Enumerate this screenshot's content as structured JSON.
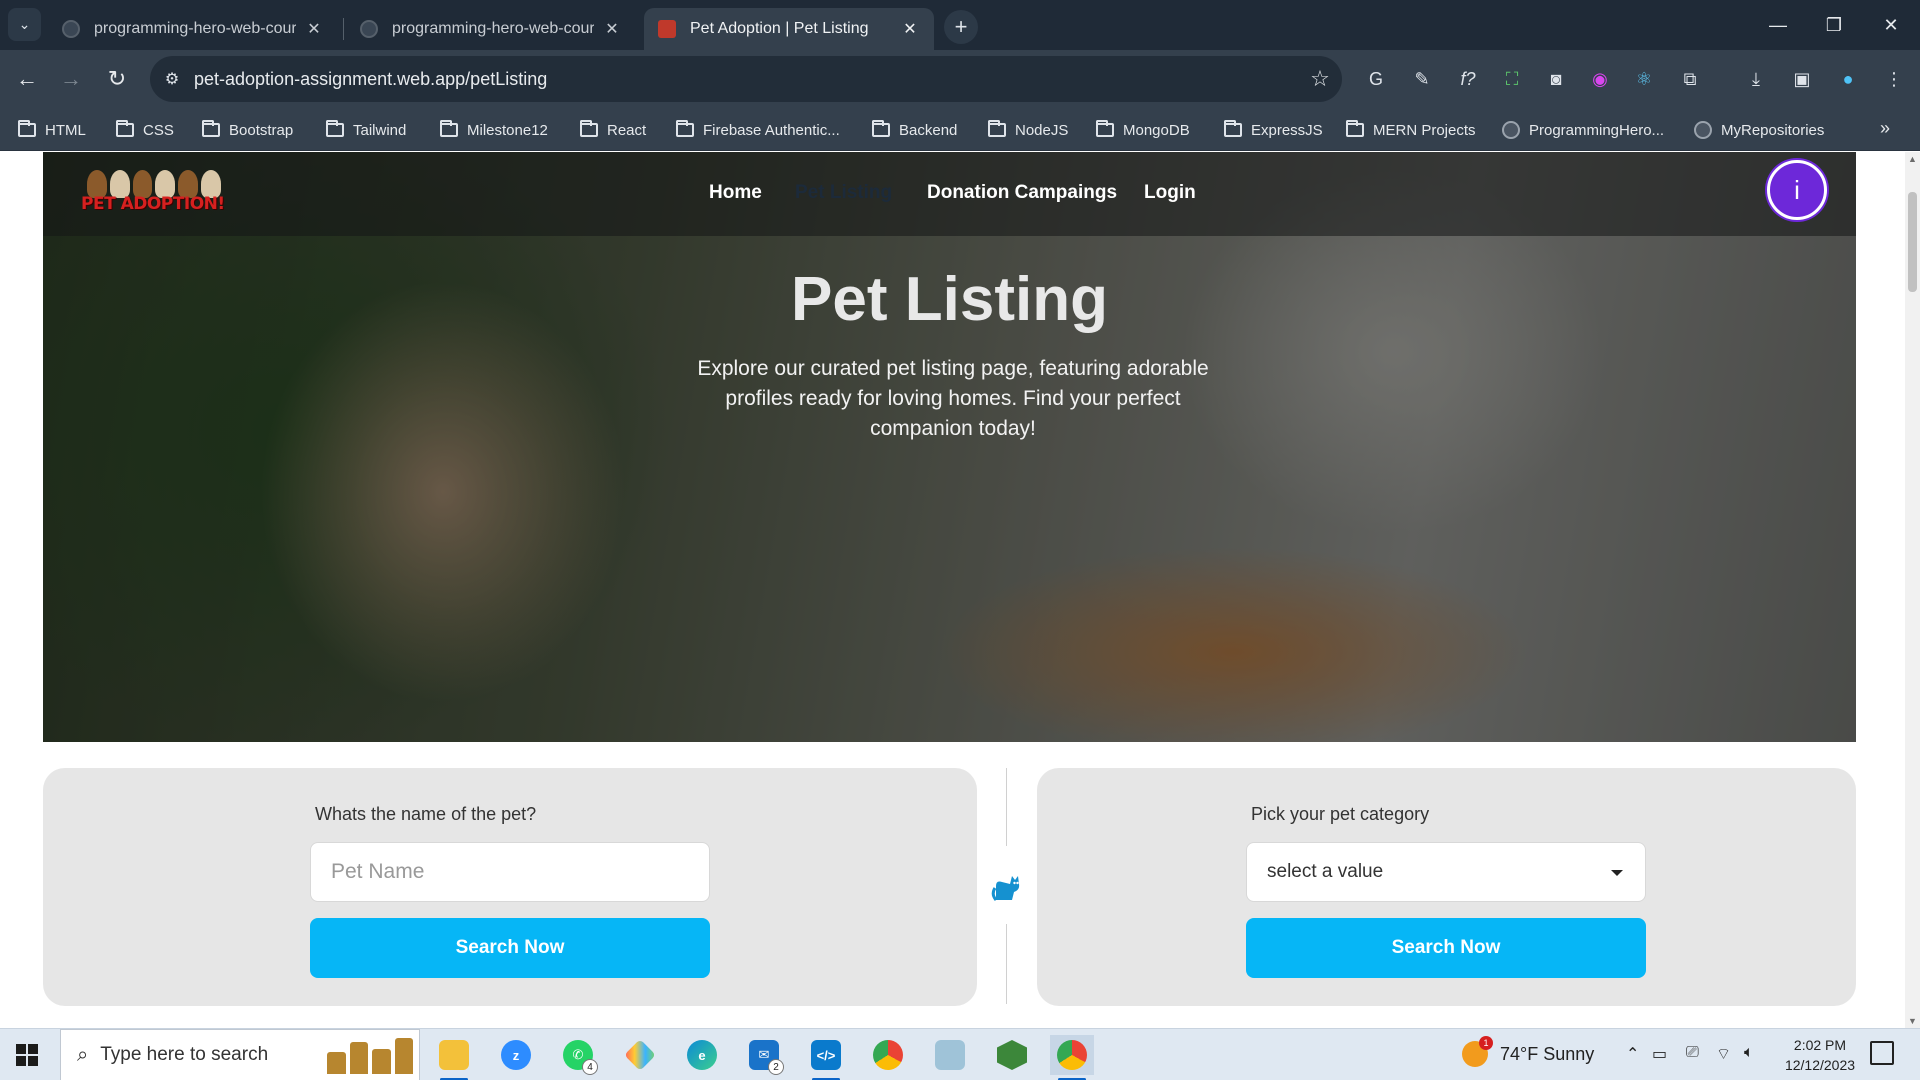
{
  "browser": {
    "tabs": [
      {
        "title": "programming-hero-web-cours",
        "close": "✕"
      },
      {
        "title": "programming-hero-web-cours",
        "close": "✕"
      },
      {
        "title": "Pet Adoption | Pet Listing",
        "close": "✕"
      }
    ],
    "new_tab": "+",
    "url": "pet-adoption-assignment.web.app/petListing",
    "bookmarks": [
      "HTML",
      "CSS",
      "Bootstrap",
      "Tailwind",
      "Milestone12",
      "React",
      "Firebase Authentic...",
      "Backend",
      "NodeJS",
      "MongoDB",
      "ExpressJS",
      "MERN Projects",
      "ProgrammingHero...",
      "MyRepositories"
    ]
  },
  "site": {
    "logo_text": "PET ADOPTION!",
    "nav": {
      "home": "Home",
      "pet_listing": "Pet Listing",
      "donation": "Donation Campaings",
      "login": "Login"
    },
    "avatar_letter": "i"
  },
  "hero": {
    "title": "Pet Listing",
    "description": "Explore our curated pet listing page, featuring adorable profiles ready for loving homes. Find your perfect companion today!"
  },
  "search": {
    "name_panel": {
      "label": "Whats the name of the pet?",
      "placeholder": "Pet Name",
      "button": "Search Now"
    },
    "category_panel": {
      "label": "Pick your pet category",
      "selected": "select a value",
      "button": "Search Now"
    }
  },
  "taskbar": {
    "search_placeholder": "Type here to search",
    "whatsapp_badge": "4",
    "mail_badge": "2",
    "weather": "74°F  Sunny",
    "weather_badge": "1",
    "time": "2:02 PM",
    "date": "12/12/2023"
  },
  "colors": {
    "accent_button": "#06b6f6",
    "avatar": "#6d28d9",
    "logo_red": "#d6201f"
  }
}
